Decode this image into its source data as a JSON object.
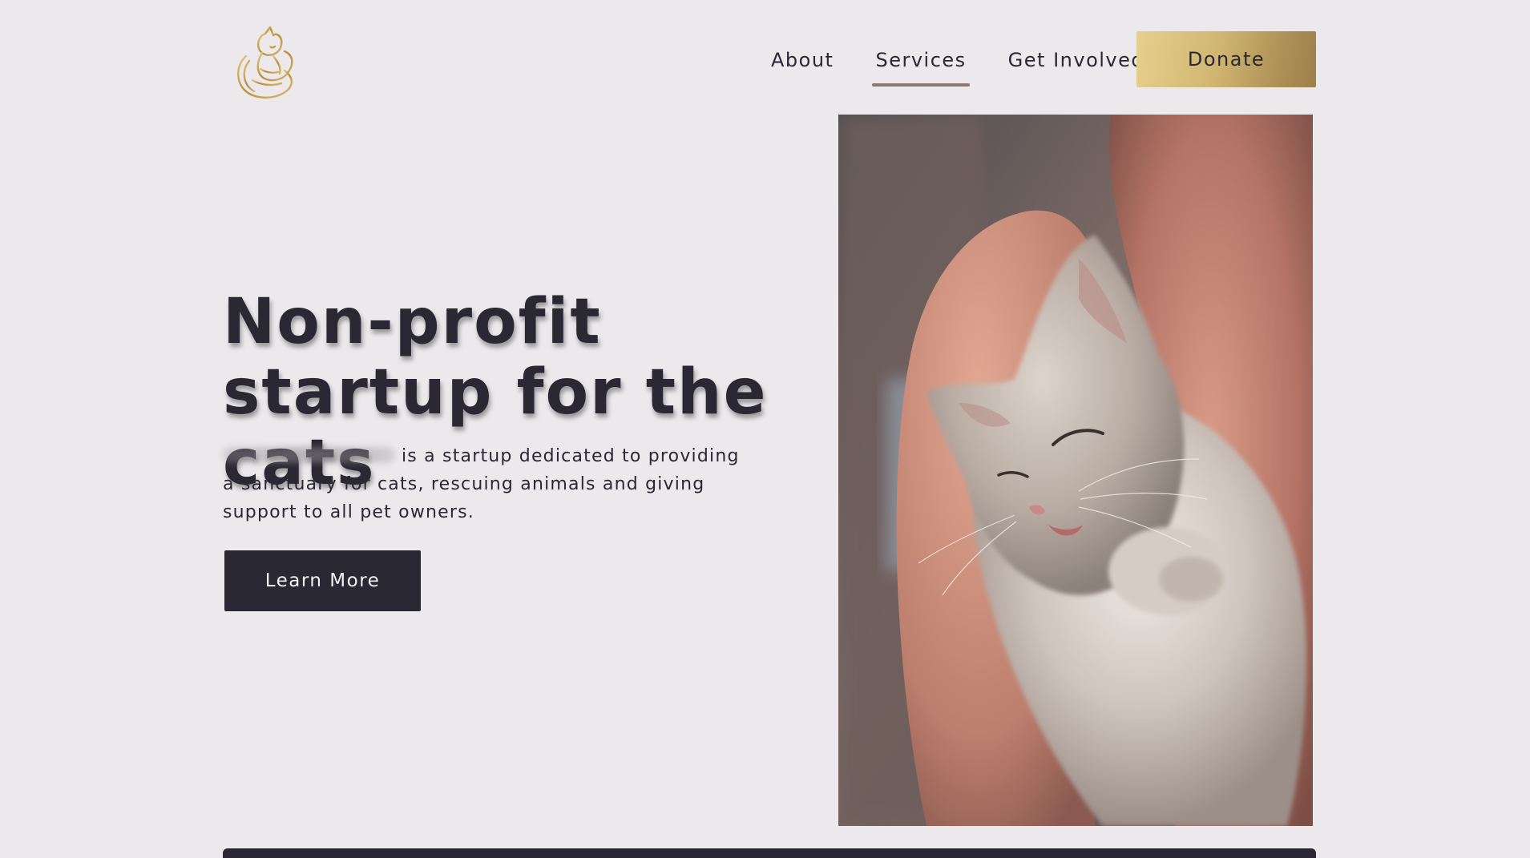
{
  "header": {
    "logo_icon": "cat-logo-icon",
    "nav": [
      {
        "label": "About",
        "active": false
      },
      {
        "label": "Services",
        "active": true
      },
      {
        "label": "Get Involved",
        "active": false
      }
    ],
    "donate_label": "Donate"
  },
  "hero": {
    "title": "Non-profit startup for the cats",
    "description": "is a startup dedicated to providing a sanctuary for cats, rescuing animals and giving support to all pet owners.",
    "cta_label": "Learn More",
    "image_icon": "sleeping-kitten-photo"
  },
  "colors": {
    "background": "#ebe9ec",
    "text": "#2a2833",
    "accent_gold": "#c9ad69",
    "nav_underline": "#8f7773",
    "button_dark": "#2a2833"
  }
}
